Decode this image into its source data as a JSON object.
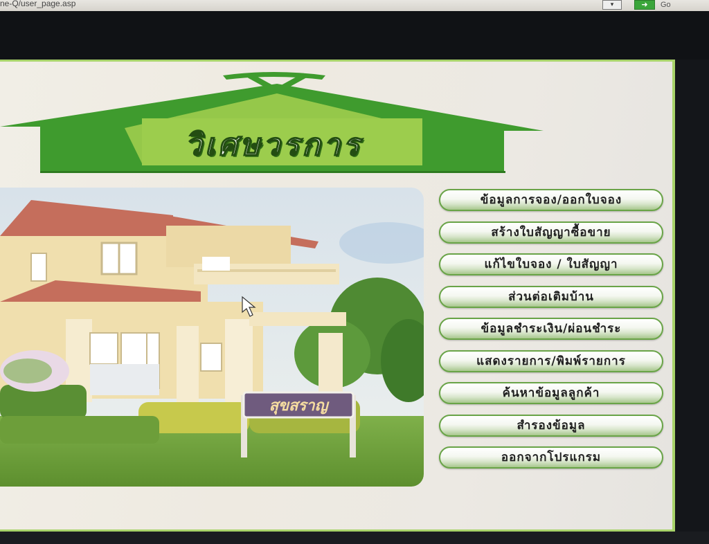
{
  "browser": {
    "address_text": "ne-Q/user_page.asp",
    "dropdown_glyph": "▾",
    "go_icon": "➜",
    "go_label": "Go"
  },
  "app": {
    "title": "วิเศษวรการ",
    "accent_color": "#3f9b2e",
    "roof_light": "#94c63f",
    "photo_sign_text": "สุขสราญ"
  },
  "menu": {
    "items": [
      {
        "label": "ข้อมูลการจอง/ออกใบจอง"
      },
      {
        "label": "สร้างใบสัญญาซื้อขาย"
      },
      {
        "label": "แก้ไขใบจอง / ใบสัญญา"
      },
      {
        "label": "ส่วนต่อเติมบ้าน"
      },
      {
        "label": "ข้อมูลชำระเงิน/ผ่อนชำระ"
      },
      {
        "label": "แสดงรายการ/พิมพ์รายการ"
      },
      {
        "label": "ค้นหาข้อมูลลูกค้า"
      },
      {
        "label": "สำรองข้อมูล"
      },
      {
        "label": "ออกจากโปรแกรม"
      }
    ]
  }
}
